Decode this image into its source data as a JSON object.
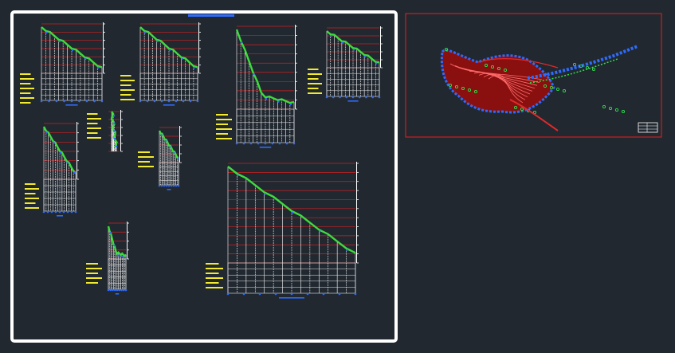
{
  "drawing": {
    "background": "#212830",
    "sheet_border_color": "#ffffff",
    "map_border_color": "#cc1f1f",
    "profile_colors": {
      "grid_red": "#d11f1f",
      "stations_white": "#ffffff",
      "ground_green": "#3ddc3d",
      "design_blue": "#2e6bff",
      "label_yellow": "#f2ea2a",
      "table_white": "#e8e8e8"
    },
    "profiles": [
      {
        "id": "p1",
        "drop_shape": "linear"
      },
      {
        "id": "p2",
        "drop_shape": "linear"
      },
      {
        "id": "p3",
        "drop_shape": "steep-then-flat"
      },
      {
        "id": "p4",
        "drop_shape": "linear"
      },
      {
        "id": "p5",
        "drop_shape": "linear"
      },
      {
        "id": "p6",
        "drop_shape": "vertical"
      },
      {
        "id": "p7",
        "drop_shape": "linear"
      },
      {
        "id": "p8",
        "drop_shape": "linear"
      },
      {
        "id": "p9",
        "drop_shape": "steep-then-flat"
      }
    ],
    "site_plan": {
      "contour_fill": "#8a1010",
      "contour_line": "#ff6a6a",
      "boundary_blue": "#2e6bff",
      "vegetation_green": "#2ee04a",
      "road_red": "#e02a2a"
    }
  }
}
